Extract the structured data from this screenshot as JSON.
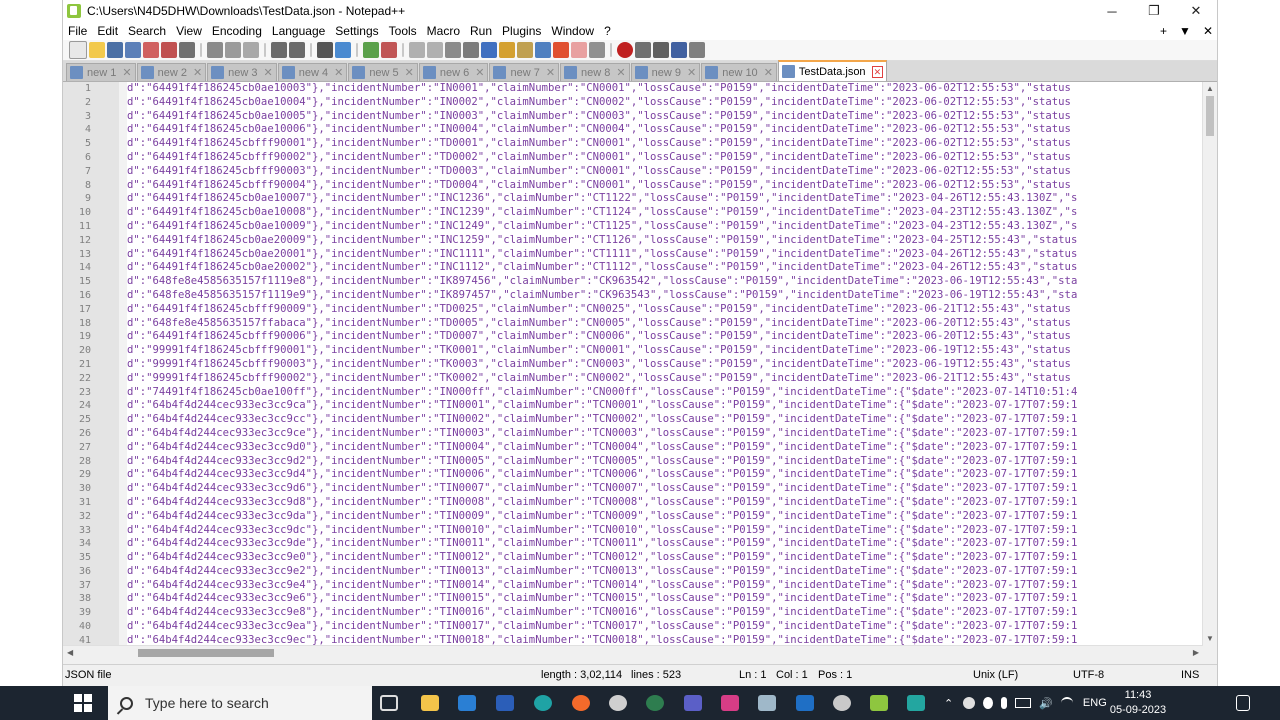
{
  "window": {
    "title": "C:\\Users\\N4D5DHW\\Downloads\\TestData.json - Notepad++",
    "minimize": "─",
    "maximize": "❐",
    "close": "✕"
  },
  "menu": {
    "items": [
      "File",
      "Edit",
      "Search",
      "View",
      "Encoding",
      "Language",
      "Settings",
      "Tools",
      "Macro",
      "Run",
      "Plugins",
      "Window",
      "?"
    ],
    "right": [
      "+",
      "▼",
      "✕"
    ]
  },
  "tabs": [
    {
      "label": "new 1",
      "active": false
    },
    {
      "label": "new 2",
      "active": false
    },
    {
      "label": "new 3",
      "active": false
    },
    {
      "label": "new 4",
      "active": false
    },
    {
      "label": "new 5",
      "active": false
    },
    {
      "label": "new 6",
      "active": false
    },
    {
      "label": "new 7",
      "active": false
    },
    {
      "label": "new 8",
      "active": false
    },
    {
      "label": "new 9",
      "active": false
    },
    {
      "label": "new 10",
      "active": false
    },
    {
      "label": "TestData.json",
      "active": true
    }
  ],
  "editor": {
    "lines": [
      "d\":\"64491f4f186245cb0ae10003\"},\"incidentNumber\":\"IN0001\",\"claimNumber\":\"CN0001\",\"lossCause\":\"P0159\",\"incidentDateTime\":\"2023-06-02T12:55:53\",\"status",
      "d\":\"64491f4f186245cb0ae10004\"},\"incidentNumber\":\"IN0002\",\"claimNumber\":\"CN0002\",\"lossCause\":\"P0159\",\"incidentDateTime\":\"2023-06-02T12:55:53\",\"status",
      "d\":\"64491f4f186245cb0ae10005\"},\"incidentNumber\":\"IN0003\",\"claimNumber\":\"CN0003\",\"lossCause\":\"P0159\",\"incidentDateTime\":\"2023-06-02T12:55:53\",\"status",
      "d\":\"64491f4f186245cb0ae10006\"},\"incidentNumber\":\"IN0004\",\"claimNumber\":\"CN0004\",\"lossCause\":\"P0159\",\"incidentDateTime\":\"2023-06-02T12:55:53\",\"status",
      "d\":\"64491f4f186245cbfff90001\"},\"incidentNumber\":\"TD0001\",\"claimNumber\":\"CN0001\",\"lossCause\":\"P0159\",\"incidentDateTime\":\"2023-06-02T12:55:53\",\"status",
      "d\":\"64491f4f186245cbfff90002\"},\"incidentNumber\":\"TD0002\",\"claimNumber\":\"CN0001\",\"lossCause\":\"P0159\",\"incidentDateTime\":\"2023-06-02T12:55:53\",\"status",
      "d\":\"64491f4f186245cbfff90003\"},\"incidentNumber\":\"TD0003\",\"claimNumber\":\"CN0001\",\"lossCause\":\"P0159\",\"incidentDateTime\":\"2023-06-02T12:55:53\",\"status",
      "d\":\"64491f4f186245cbfff90004\"},\"incidentNumber\":\"TD0004\",\"claimNumber\":\"CN0001\",\"lossCause\":\"P0159\",\"incidentDateTime\":\"2023-06-02T12:55:53\",\"status",
      "d\":\"64491f4f186245cb0ae10007\"},\"incidentNumber\":\"INC1236\",\"claimNumber\":\"CT1122\",\"lossCause\":\"P0159\",\"incidentDateTime\":\"2023-04-26T12:55:43.130Z\",\"s",
      "d\":\"64491f4f186245cb0ae10008\"},\"incidentNumber\":\"INC1239\",\"claimNumber\":\"CT1124\",\"lossCause\":\"P0159\",\"incidentDateTime\":\"2023-04-23T12:55:43.130Z\",\"s",
      "d\":\"64491f4f186245cb0ae10009\"},\"incidentNumber\":\"INC1249\",\"claimNumber\":\"CT1125\",\"lossCause\":\"P0159\",\"incidentDateTime\":\"2023-04-23T12:55:43.130Z\",\"s",
      "d\":\"64491f4f186245cb0ae20009\"},\"incidentNumber\":\"INC1259\",\"claimNumber\":\"CT1126\",\"lossCause\":\"P0159\",\"incidentDateTime\":\"2023-04-25T12:55:43\",\"status",
      "d\":\"64491f4f186245cb0ae20001\"},\"incidentNumber\":\"INC1111\",\"claimNumber\":\"CT1111\",\"lossCause\":\"P0159\",\"incidentDateTime\":\"2023-04-26T12:55:43\",\"status",
      "d\":\"64491f4f186245cb0ae20002\"},\"incidentNumber\":\"INC1112\",\"claimNumber\":\"CT1112\",\"lossCause\":\"P0159\",\"incidentDateTime\":\"2023-04-26T12:55:43\",\"status",
      "d\":\"648fe8e4585635157f1119e8\"},\"incidentNumber\":\"IK897456\",\"claimNumber\":\"CK963542\",\"lossCause\":\"P0159\",\"incidentDateTime\":\"2023-06-19T12:55:43\",\"sta",
      "d\":\"648fe8e4585635157f1119e9\"},\"incidentNumber\":\"IK897457\",\"claimNumber\":\"CK963543\",\"lossCause\":\"P0159\",\"incidentDateTime\":\"2023-06-19T12:55:43\",\"sta",
      "d\":\"64491f4f186245cbfff90009\"},\"incidentNumber\":\"TD0025\",\"claimNumber\":\"CN0025\",\"lossCause\":\"P0159\",\"incidentDateTime\":\"2023-06-21T12:55:43\",\"status",
      "d\":\"648fe8e4585635157ffabaca\"},\"incidentNumber\":\"TD0005\",\"claimNumber\":\"CN0005\",\"lossCause\":\"P0159\",\"incidentDateTime\":\"2023-06-20T12:55:43\",\"status",
      "d\":\"64491f4f186245cbfff90006\"},\"incidentNumber\":\"TD0007\",\"claimNumber\":\"CN0006\",\"lossCause\":\"P0159\",\"incidentDateTime\":\"2023-06-20T12:55:43\",\"status",
      "d\":\"99991f4f186245cbfff90001\"},\"incidentNumber\":\"TK0001\",\"claimNumber\":\"CN0001\",\"lossCause\":\"P0159\",\"incidentDateTime\":\"2023-06-19T12:55:43\",\"status",
      "d\":\"99991f4f186245cbfff90003\"},\"incidentNumber\":\"TK0003\",\"claimNumber\":\"CN0003\",\"lossCause\":\"P0159\",\"incidentDateTime\":\"2023-06-19T12:55:43\",\"status",
      "d\":\"99991f4f186245cbfff90002\"},\"incidentNumber\":\"TK0002\",\"claimNumber\":\"CN0002\",\"lossCause\":\"P0159\",\"incidentDateTime\":\"2023-06-21T12:55:43\",\"status",
      "d\":\"74491f4f186245cb0ae100ff\"},\"incidentNumber\":\"IN000ff\",\"claimNumber\":\"CN000ff\",\"lossCause\":\"P0159\",\"incidentDateTime\":{\"$date\":\"2023-07-14T10:51:4",
      "d\":\"64b4f4d244cec933ec3cc9ca\"},\"incidentNumber\":\"TIN0001\",\"claimNumber\":\"TCN0001\",\"lossCause\":\"P0159\",\"incidentDateTime\":{\"$date\":\"2023-07-17T07:59:1",
      "d\":\"64b4f4d244cec933ec3cc9cc\"},\"incidentNumber\":\"TIN0002\",\"claimNumber\":\"TCN0002\",\"lossCause\":\"P0159\",\"incidentDateTime\":{\"$date\":\"2023-07-17T07:59:1",
      "d\":\"64b4f4d244cec933ec3cc9ce\"},\"incidentNumber\":\"TIN0003\",\"claimNumber\":\"TCN0003\",\"lossCause\":\"P0159\",\"incidentDateTime\":{\"$date\":\"2023-07-17T07:59:1",
      "d\":\"64b4f4d244cec933ec3cc9d0\"},\"incidentNumber\":\"TIN0004\",\"claimNumber\":\"TCN0004\",\"lossCause\":\"P0159\",\"incidentDateTime\":{\"$date\":\"2023-07-17T07:59:1",
      "d\":\"64b4f4d244cec933ec3cc9d2\"},\"incidentNumber\":\"TIN0005\",\"claimNumber\":\"TCN0005\",\"lossCause\":\"P0159\",\"incidentDateTime\":{\"$date\":\"2023-07-17T07:59:1",
      "d\":\"64b4f4d244cec933ec3cc9d4\"},\"incidentNumber\":\"TIN0006\",\"claimNumber\":\"TCN0006\",\"lossCause\":\"P0159\",\"incidentDateTime\":{\"$date\":\"2023-07-17T07:59:1",
      "d\":\"64b4f4d244cec933ec3cc9d6\"},\"incidentNumber\":\"TIN0007\",\"claimNumber\":\"TCN0007\",\"lossCause\":\"P0159\",\"incidentDateTime\":{\"$date\":\"2023-07-17T07:59:1",
      "d\":\"64b4f4d244cec933ec3cc9d8\"},\"incidentNumber\":\"TIN0008\",\"claimNumber\":\"TCN0008\",\"lossCause\":\"P0159\",\"incidentDateTime\":{\"$date\":\"2023-07-17T07:59:1",
      "d\":\"64b4f4d244cec933ec3cc9da\"},\"incidentNumber\":\"TIN0009\",\"claimNumber\":\"TCN0009\",\"lossCause\":\"P0159\",\"incidentDateTime\":{\"$date\":\"2023-07-17T07:59:1",
      "d\":\"64b4f4d244cec933ec3cc9dc\"},\"incidentNumber\":\"TIN0010\",\"claimNumber\":\"TCN0010\",\"lossCause\":\"P0159\",\"incidentDateTime\":{\"$date\":\"2023-07-17T07:59:1",
      "d\":\"64b4f4d244cec933ec3cc9de\"},\"incidentNumber\":\"TIN0011\",\"claimNumber\":\"TCN0011\",\"lossCause\":\"P0159\",\"incidentDateTime\":{\"$date\":\"2023-07-17T07:59:1",
      "d\":\"64b4f4d244cec933ec3cc9e0\"},\"incidentNumber\":\"TIN0012\",\"claimNumber\":\"TCN0012\",\"lossCause\":\"P0159\",\"incidentDateTime\":{\"$date\":\"2023-07-17T07:59:1",
      "d\":\"64b4f4d244cec933ec3cc9e2\"},\"incidentNumber\":\"TIN0013\",\"claimNumber\":\"TCN0013\",\"lossCause\":\"P0159\",\"incidentDateTime\":{\"$date\":\"2023-07-17T07:59:1",
      "d\":\"64b4f4d244cec933ec3cc9e4\"},\"incidentNumber\":\"TIN0014\",\"claimNumber\":\"TCN0014\",\"lossCause\":\"P0159\",\"incidentDateTime\":{\"$date\":\"2023-07-17T07:59:1",
      "d\":\"64b4f4d244cec933ec3cc9e6\"},\"incidentNumber\":\"TIN0015\",\"claimNumber\":\"TCN0015\",\"lossCause\":\"P0159\",\"incidentDateTime\":{\"$date\":\"2023-07-17T07:59:1",
      "d\":\"64b4f4d244cec933ec3cc9e8\"},\"incidentNumber\":\"TIN0016\",\"claimNumber\":\"TCN0016\",\"lossCause\":\"P0159\",\"incidentDateTime\":{\"$date\":\"2023-07-17T07:59:1",
      "d\":\"64b4f4d244cec933ec3cc9ea\"},\"incidentNumber\":\"TIN0017\",\"claimNumber\":\"TCN0017\",\"lossCause\":\"P0159\",\"incidentDateTime\":{\"$date\":\"2023-07-17T07:59:1",
      "d\":\"64b4f4d244cec933ec3cc9ec\"},\"incidentNumber\":\"TIN0018\",\"claimNumber\":\"TCN0018\",\"lossCause\":\"P0159\",\"incidentDateTime\":{\"$date\":\"2023-07-17T07:59:1"
    ]
  },
  "status": {
    "filetype": "JSON file",
    "length": "length : 3,02,114",
    "lines": "lines : 523",
    "ln": "Ln : 1",
    "col": "Col : 1",
    "pos": "Pos : 1",
    "eol": "Unix (LF)",
    "encoding": "UTF-8",
    "mode": "INS"
  },
  "taskbar": {
    "search_placeholder": "Type here to search",
    "language": "ENG",
    "time": "11:43",
    "date": "05-09-2023"
  },
  "colors": {
    "code_text": "#7a3fa0",
    "active_tab_accent": "#f3a64a",
    "taskbar": "#1c2530"
  }
}
